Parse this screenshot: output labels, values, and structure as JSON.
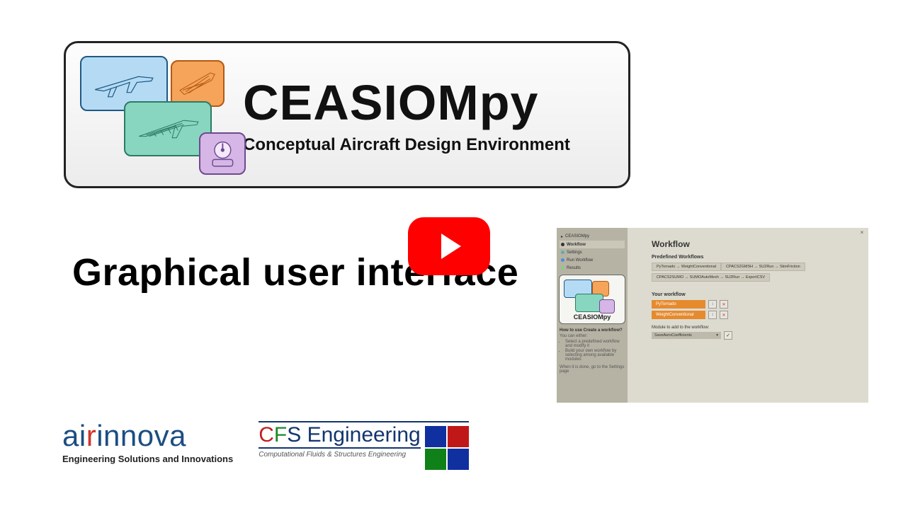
{
  "banner": {
    "title": "CEASIOMpy",
    "subtitle": "Conceptual Aircraft Design Environment"
  },
  "heading": "Graphical user interface",
  "play_button": {
    "label": "play-video"
  },
  "screenshot": {
    "close_label": "×",
    "nav": {
      "app": "CEASIOMpy",
      "items": [
        {
          "label": "Workflow",
          "selected": true,
          "dot": "#333"
        },
        {
          "label": "Settings",
          "selected": false,
          "dot": "#6aa"
        },
        {
          "label": "Run Workflow",
          "selected": false,
          "dot": "#4a8fd6"
        },
        {
          "label": "Results",
          "selected": false,
          "dot": "#8c8"
        }
      ],
      "logo_text": "CEASIOMpy",
      "help_heading": "How to use Create a workflow?",
      "help_intro": "You can either:",
      "help_bullets": [
        "Select a predefined workflow and modify it",
        "Build your own workflow by selecting among available modules"
      ],
      "help_outro": "When it is done, go to the Settings page"
    },
    "main": {
      "title": "Workflow",
      "predef_heading": "Predefined Workflows",
      "predef": [
        "PyTornado → WeightConventional",
        "CPACS2GMSH → SU2Run → SkinFriction",
        "CPACS2SUMO → SUMOAutoMesh → SU2Run → ExportCSV"
      ],
      "your_heading": "Your workflow",
      "your_items": [
        "PyTornado",
        "WeightConventional"
      ],
      "row_btn_move": "↕",
      "row_btn_del": "✕",
      "add_label": "Module to add to the workflow:",
      "add_selected": "SaveAeroCoefficients",
      "add_confirm": "✓"
    }
  },
  "footer": {
    "airinnova": {
      "word_pre": "ai",
      "word_r": "r",
      "word_post": "innova",
      "tag": "Engineering Solutions and Innovations"
    },
    "cfs": {
      "c": "C",
      "f": "F",
      "s": "S",
      "rest": " Engineering",
      "tag": "Computational Fluids & Structures Engineering"
    }
  }
}
